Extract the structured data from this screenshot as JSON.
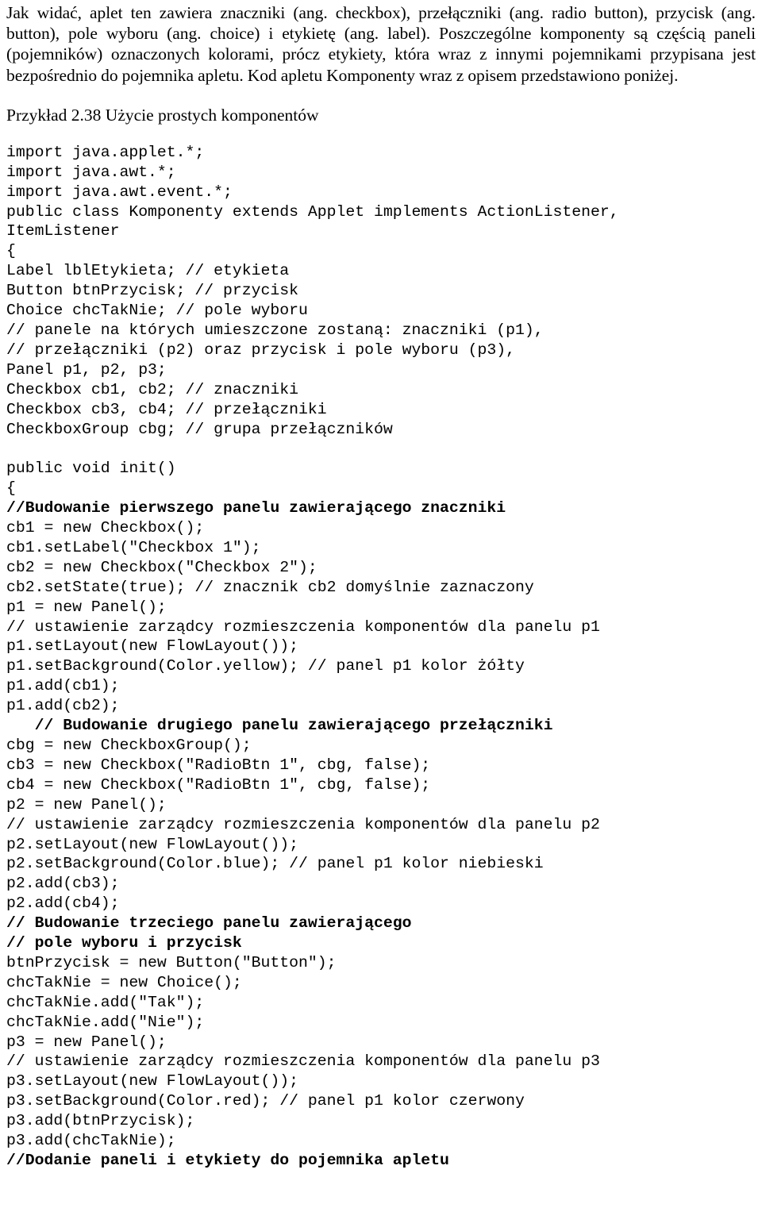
{
  "document": {
    "intro_paragraph": "Jak widać, aplet ten zawiera znaczniki (ang. checkbox), przełączniki (ang. radio button), przycisk (ang. button), pole wyboru (ang. choice) i etykietę (ang. label). Poszczególne komponenty są częścią paneli (pojemników) oznaczonych kolorami, prócz etykiety, która wraz z innymi pojemnikami przypisana jest bezpośrednio do pojemnika apletu. Kod apletu Komponenty wraz z opisem przedstawiono poniżej.",
    "example_heading": "Przykład 2.38 Użycie prostych komponentów",
    "code_lines": [
      {
        "text": "import java.applet.*;",
        "bold": false
      },
      {
        "text": "import java.awt.*;",
        "bold": false
      },
      {
        "text": "import java.awt.event.*;",
        "bold": false
      },
      {
        "text": "public class Komponenty extends Applet implements ActionListener,",
        "bold": false
      },
      {
        "text": "ItemListener",
        "bold": false
      },
      {
        "text": "{",
        "bold": false
      },
      {
        "text": "Label lblEtykieta; // etykieta",
        "bold": false
      },
      {
        "text": "Button btnPrzycisk; // przycisk",
        "bold": false
      },
      {
        "text": "Choice chcTakNie; // pole wyboru",
        "bold": false
      },
      {
        "text": "// panele na których umieszczone zostaną: znaczniki (p1),",
        "bold": false
      },
      {
        "text": "// przełączniki (p2) oraz przycisk i pole wyboru (p3),",
        "bold": false
      },
      {
        "text": "Panel p1, p2, p3;",
        "bold": false
      },
      {
        "text": "Checkbox cb1, cb2; // znaczniki",
        "bold": false
      },
      {
        "text": "Checkbox cb3, cb4; // przełączniki",
        "bold": false
      },
      {
        "text": "CheckboxGroup cbg; // grupa przełączników",
        "bold": false
      },
      {
        "text": "",
        "bold": false
      },
      {
        "text": "public void init()",
        "bold": false
      },
      {
        "text": "{",
        "bold": false
      },
      {
        "text": "//Budowanie pierwszego panelu zawierającego znaczniki",
        "bold": true
      },
      {
        "text": "cb1 = new Checkbox();",
        "bold": false
      },
      {
        "text": "cb1.setLabel(\"Checkbox 1\");",
        "bold": false
      },
      {
        "text": "cb2 = new Checkbox(\"Checkbox 2\");",
        "bold": false
      },
      {
        "text": "cb2.setState(true); // znacznik cb2 domyślnie zaznaczony",
        "bold": false
      },
      {
        "text": "p1 = new Panel();",
        "bold": false
      },
      {
        "text": "// ustawienie zarządcy rozmieszczenia komponentów dla panelu p1",
        "bold": false
      },
      {
        "text": "p1.setLayout(new FlowLayout());",
        "bold": false
      },
      {
        "text": "p1.setBackground(Color.yellow); // panel p1 kolor żółty",
        "bold": false
      },
      {
        "text": "p1.add(cb1);",
        "bold": false
      },
      {
        "text": "p1.add(cb2);",
        "bold": false
      },
      {
        "text": "   // Budowanie drugiego panelu zawierającego przełączniki",
        "bold": true
      },
      {
        "text": "cbg = new CheckboxGroup();",
        "bold": false
      },
      {
        "text": "cb3 = new Checkbox(\"RadioBtn 1\", cbg, false);",
        "bold": false
      },
      {
        "text": "cb4 = new Checkbox(\"RadioBtn 1\", cbg, false);",
        "bold": false
      },
      {
        "text": "p2 = new Panel();",
        "bold": false
      },
      {
        "text": "// ustawienie zarządcy rozmieszczenia komponentów dla panelu p2",
        "bold": false
      },
      {
        "text": "p2.setLayout(new FlowLayout());",
        "bold": false
      },
      {
        "text": "p2.setBackground(Color.blue); // panel p1 kolor niebieski",
        "bold": false
      },
      {
        "text": "p2.add(cb3);",
        "bold": false
      },
      {
        "text": "p2.add(cb4);",
        "bold": false
      },
      {
        "text": "// Budowanie trzeciego panelu zawierającego",
        "bold": true
      },
      {
        "text": "// pole wyboru i przycisk",
        "bold": true
      },
      {
        "text": "btnPrzycisk = new Button(\"Button\");",
        "bold": false
      },
      {
        "text": "chcTakNie = new Choice();",
        "bold": false
      },
      {
        "text": "chcTakNie.add(\"Tak\");",
        "bold": false
      },
      {
        "text": "chcTakNie.add(\"Nie\");",
        "bold": false
      },
      {
        "text": "p3 = new Panel();",
        "bold": false
      },
      {
        "text": "// ustawienie zarządcy rozmieszczenia komponentów dla panelu p3",
        "bold": false
      },
      {
        "text": "p3.setLayout(new FlowLayout());",
        "bold": false
      },
      {
        "text": "p3.setBackground(Color.red); // panel p1 kolor czerwony",
        "bold": false
      },
      {
        "text": "p3.add(btnPrzycisk);",
        "bold": false
      },
      {
        "text": "p3.add(chcTakNie);",
        "bold": false
      },
      {
        "text": "//Dodanie paneli i etykiety do pojemnika apletu",
        "bold": true
      }
    ]
  }
}
